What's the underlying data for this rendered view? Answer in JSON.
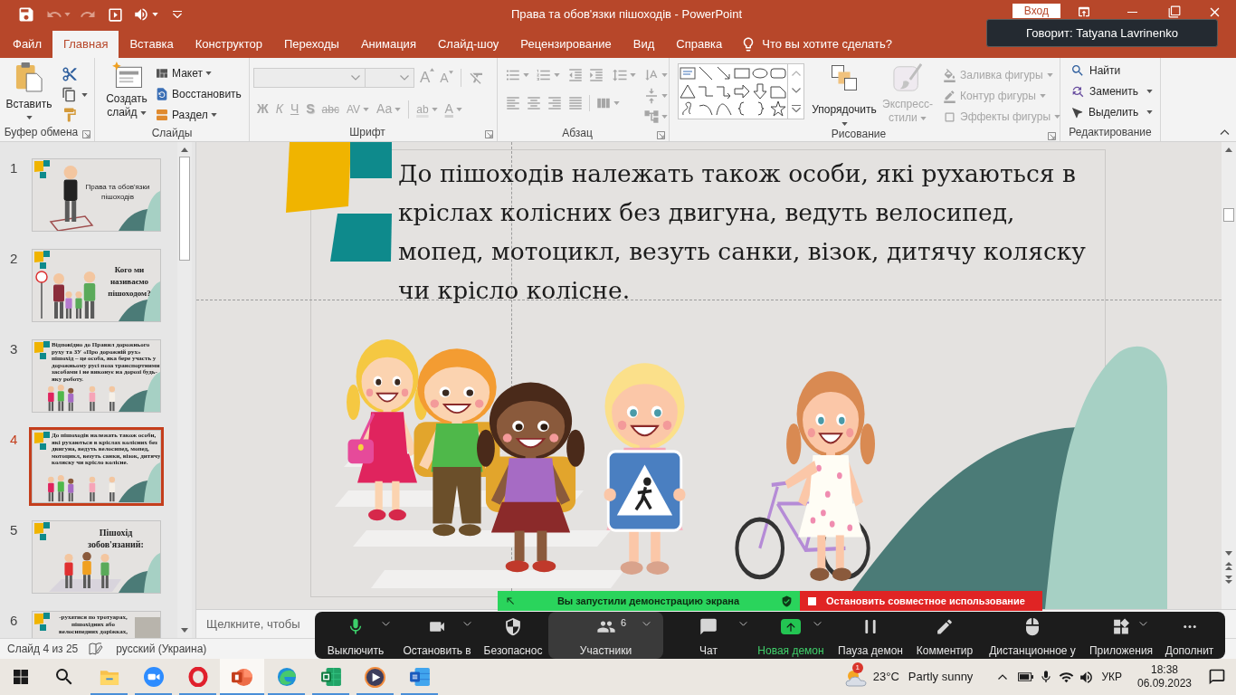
{
  "title_bar": {
    "title": "Права та обов'язки пішоходів - PowerPoint",
    "sign_in": "Вход"
  },
  "speaker_tooltip": {
    "text": "Говорит: Tatyana Lavrinenko"
  },
  "ribbon_tabs": [
    {
      "label": "Файл",
      "selected": false
    },
    {
      "label": "Главная",
      "selected": true
    },
    {
      "label": "Вставка",
      "selected": false
    },
    {
      "label": "Конструктор",
      "selected": false
    },
    {
      "label": "Переходы",
      "selected": false
    },
    {
      "label": "Анимация",
      "selected": false
    },
    {
      "label": "Слайд-шоу",
      "selected": false
    },
    {
      "label": "Рецензирование",
      "selected": false
    },
    {
      "label": "Вид",
      "selected": false
    },
    {
      "label": "Справка",
      "selected": false
    }
  ],
  "tell_me": {
    "label": "Что вы хотите сделать?"
  },
  "ribbon": {
    "clipboard": {
      "paste": "Вставить",
      "title": "Буфер обмена"
    },
    "slides": {
      "new_slide": "Создать слайд",
      "commands": [
        {
          "label": "Макет",
          "kind": "layout",
          "dropdown": true
        },
        {
          "label": "Восстановить",
          "kind": "reset",
          "dropdown": false
        },
        {
          "label": "Раздел",
          "kind": "section",
          "dropdown": true
        }
      ],
      "title": "Слайды"
    },
    "font": {
      "disabled": true,
      "size_buttons": [
        {
          "label": "A",
          "kind": "grow"
        },
        {
          "label": "A",
          "kind": "shrink"
        }
      ],
      "format_buttons": [
        {
          "label": "Ж",
          "kind": "bold",
          "dropdown": false
        },
        {
          "label": "К",
          "kind": "italic",
          "dropdown": false
        },
        {
          "label": "Ч",
          "kind": "underline",
          "dropdown": false
        },
        {
          "label": "S",
          "kind": "shadow",
          "dropdown": false
        },
        {
          "label": "abc",
          "kind": "strike",
          "dropdown": false
        },
        {
          "label": "AV",
          "kind": "spacing",
          "dropdown": true
        },
        {
          "label": "Aa",
          "kind": "case",
          "dropdown": true
        },
        {
          "label": "ab",
          "kind": "highlight",
          "dropdown": true
        },
        {
          "label": "A",
          "kind": "color",
          "dropdown": true
        }
      ],
      "title": "Шрифт"
    },
    "paragraph": {
      "disabled": true,
      "title": "Абзац"
    },
    "drawing": {
      "arrange": "Упорядочить",
      "quick_styles": {
        "label": "Экспресс-стили",
        "disabled": true
      },
      "format_buttons": [
        {
          "label": "Заливка фигуры",
          "kind": "fill",
          "disabled": true
        },
        {
          "label": "Контур фигуры",
          "kind": "outline",
          "disabled": true
        },
        {
          "label": "Эффекты фигуры",
          "kind": "effects",
          "disabled": true
        }
      ],
      "title": "Рисование"
    },
    "editing": {
      "commands": [
        {
          "label": "Найти",
          "kind": "find",
          "dropdown": false
        },
        {
          "label": "Заменить",
          "kind": "replace",
          "dropdown": true
        },
        {
          "label": "Выделить",
          "kind": "select",
          "dropdown": true
        }
      ],
      "title": "Редактирование"
    }
  },
  "slides": [
    {
      "number": "1",
      "text": "Права та обов'язки пішоходів",
      "kind": "title",
      "selected": false
    },
    {
      "number": "2",
      "text": "Кого ми називаємо пішоходом?",
      "kind": "question",
      "selected": false
    },
    {
      "number": "3",
      "text": "Відповідно до Правил дорожнього руху та ЗУ «Про дорожній рух» пішохід – це особа, яка бере участь у дорожньому русі поза транспортними засобами і не виконує на дорозі будь-яку роботу.",
      "kind": "text",
      "selected": false
    },
    {
      "number": "4",
      "text": "До пішоходів належать також особи, які рухаються в кріслах колісних без двигуна, ведуть велосипед, мопед, мотоцикл, везуть санки, візок, дитячу коляску чи крісло колісне.",
      "kind": "text",
      "selected": true
    },
    {
      "number": "5",
      "text": "Пішохід зобов'язаний:",
      "kind": "heading",
      "selected": false
    },
    {
      "number": "6",
      "text": "-рухатися по тротуарах, пішохідних або велосипедних доріжках,",
      "kind": "list",
      "selected": false
    }
  ],
  "slide": {
    "body": "До пішоходів належать також особи, які рухаються в кріслах колісних без двигуна, ведуть велосипед, мопед, мотоцикл, везуть санки, візок, дитячу коляску чи крісло колісне."
  },
  "notes": {
    "placeholder": "Щелкните, чтобы"
  },
  "status_bar": {
    "slide_position": "Слайд 4 из 25",
    "language": "русский (Украина)"
  },
  "zoom": {
    "banner": {
      "sharing": "Вы запустили демонстрацию экрана",
      "stop": "Остановить совместное использование"
    },
    "items": [
      {
        "label": "Выключить",
        "kind": "mic",
        "selected": false
      },
      {
        "label": "Остановить в",
        "kind": "video",
        "selected": false
      },
      {
        "label": "Безопаснос",
        "kind": "security",
        "selected": false
      },
      {
        "label": "Участники",
        "kind": "participants",
        "count": "6",
        "selected": true
      },
      {
        "label": "Чат",
        "kind": "chat",
        "selected": false
      },
      {
        "label": "Новая демон",
        "kind": "share",
        "selected": false
      },
      {
        "label": "Пауза демон",
        "kind": "pause",
        "selected": false
      },
      {
        "label": "Комментир",
        "kind": "annotate",
        "selected": false
      },
      {
        "label": "Дистанционное у",
        "kind": "remote",
        "selected": false
      },
      {
        "label": "Приложения",
        "kind": "apps",
        "selected": false
      },
      {
        "label": "Дополнит",
        "kind": "more",
        "selected": false
      }
    ]
  },
  "taskbar": {
    "apps": [
      {
        "kind": "explorer",
        "selected": false,
        "running": true
      },
      {
        "kind": "zoom",
        "selected": false,
        "running": true
      },
      {
        "kind": "opera",
        "selected": false,
        "running": true
      },
      {
        "kind": "powerpoint",
        "selected": true,
        "running": true
      },
      {
        "kind": "edge",
        "selected": false,
        "running": true
      },
      {
        "kind": "excel",
        "selected": false,
        "running": true
      },
      {
        "kind": "player",
        "selected": false,
        "running": true
      },
      {
        "kind": "word",
        "selected": false,
        "running": true
      }
    ],
    "weather": {
      "badge": "1",
      "temperature": "23°C",
      "condition": "Partly sunny"
    },
    "language": "УКР",
    "time": "18:38",
    "date": "06.09.2023"
  }
}
